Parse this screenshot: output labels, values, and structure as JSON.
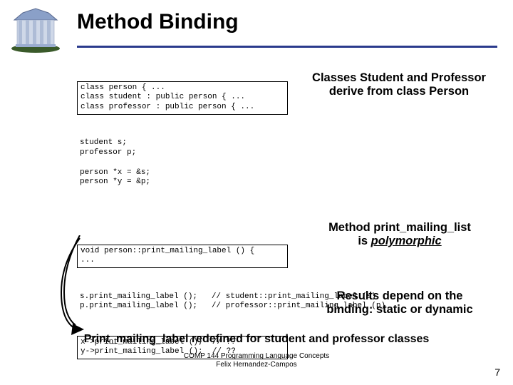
{
  "title": "Method Binding",
  "code": {
    "block1": "class person { ...\nclass student : public person { ...\nclass professor : public person { ...",
    "block2": "student s;\nprofessor p;\n\nperson *x = &s;\nperson *y = &p;",
    "block3": "void person::print_mailing_label () {\n...",
    "block4": "s.print_mailing_label ();   // student::print_mailing_label (s)\np.print_mailing_label ();   // professor::print_mailing_label (p)",
    "block5": "x->print_mailing_label ();  // ??\ny->print_mailing_label ();  // ??"
  },
  "notes": {
    "n1_l1": "Classes Student and Professor",
    "n1_l2": "derive from class Person",
    "n2_l1": "Method print_mailing_list",
    "n2_prefix": "is ",
    "n2_poly": "polymorphic",
    "n3_l1": "Results depend on the",
    "n3_l2": "binding: static or dynamic",
    "bottom": "Print_mailing_label redefined for student and professor classes"
  },
  "footer": {
    "l1": "COMP 144 Programming Language Concepts",
    "l2": "Felix Hernandez-Campos"
  },
  "page_number": "7"
}
